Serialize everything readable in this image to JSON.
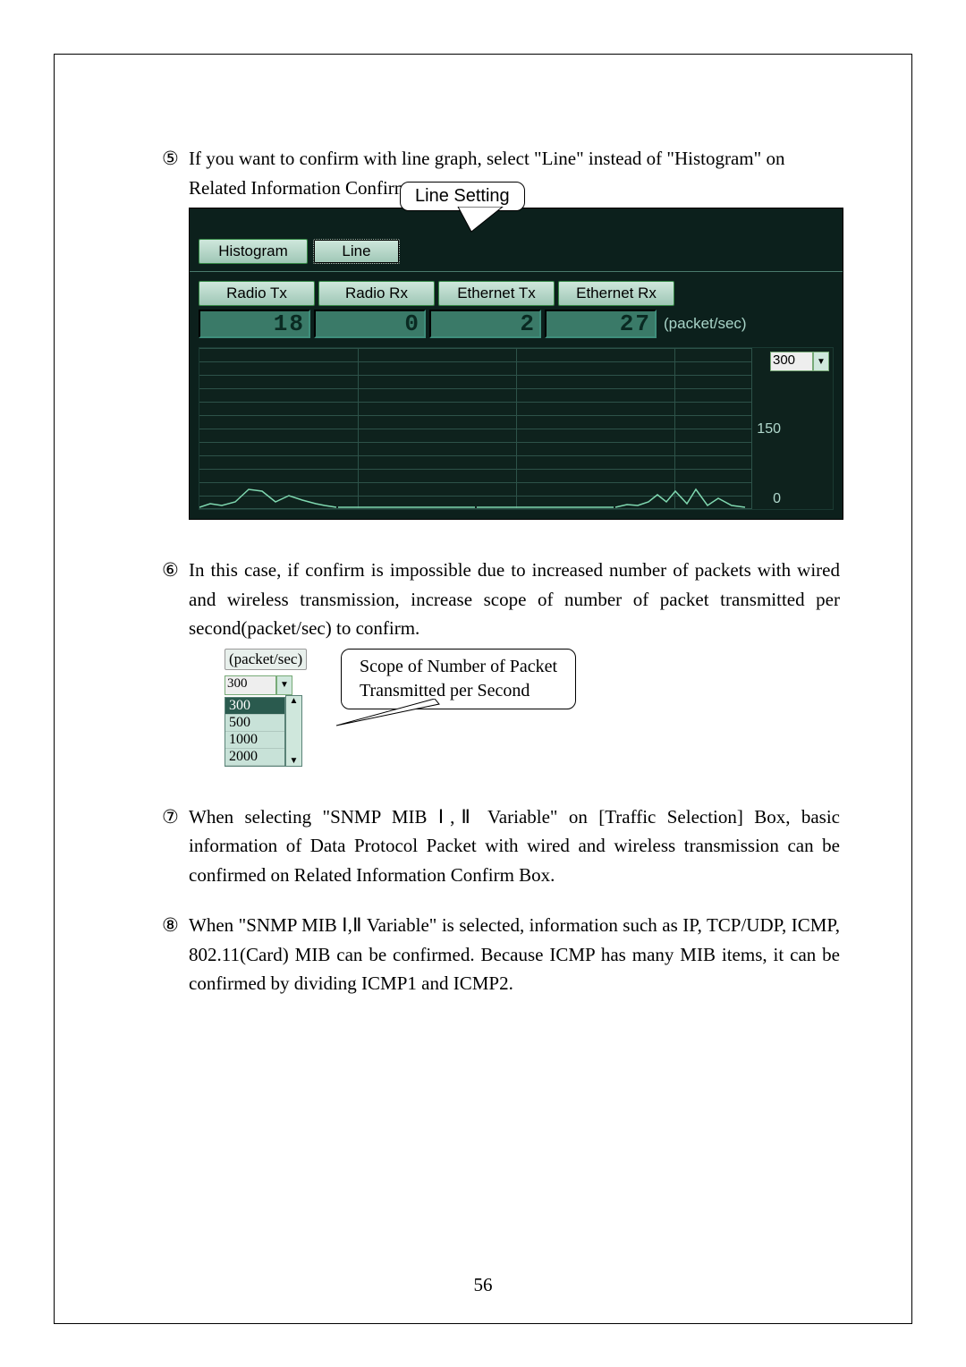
{
  "page_number": "56",
  "items": {
    "5": {
      "marker": "⑤",
      "text": "If you want to confirm with line graph, select \"Line\" instead of \"Histogram\" on Related Information Confirm Box."
    },
    "6": {
      "marker": "⑥",
      "text": "In this case, if confirm is impossible due to increased number of packets with wired and wireless transmission, increase scope of number of packet transmitted per second(packet/sec) to confirm."
    },
    "7": {
      "marker": "⑦",
      "text": "When selecting \"SNMP MIB Ⅰ,Ⅱ Variable\" on [Traffic Selection] Box, basic information of Data Protocol Packet with wired and wireless transmission can be confirmed on Related Information Confirm Box."
    },
    "8": {
      "marker": "⑧",
      "text": "When \"SNMP MIB Ⅰ,Ⅱ Variable\" is selected, information such as IP, TCP/UDP, ICMP, 802.11(Card) MIB can be confirmed. Because ICMP has many MIB items, it can be confirmed by dividing ICMP1 and ICMP2."
    }
  },
  "fig1": {
    "callout": "Line Setting",
    "tabs": {
      "histogram": "Histogram",
      "line": "Line"
    },
    "headers": {
      "radioTx": "Radio Tx",
      "radioRx": "Radio Rx",
      "ethTx": "Ethernet Tx",
      "ethRx": "Ethernet Rx"
    },
    "lcd": {
      "radioTx": "18",
      "radioRx": "0",
      "ethTx": "2",
      "ethRx": "27"
    },
    "unit": "(packet/sec)",
    "scale_value": "300",
    "y_mid": "150",
    "y_min": "0"
  },
  "fig2": {
    "unit": "(packet/sec)",
    "selected": "300",
    "options": [
      "300",
      "500",
      "1000",
      "2000"
    ],
    "callout_l1": "Scope of Number of Packet",
    "callout_l2": "Transmitted per Second"
  },
  "chart_data": {
    "type": "line",
    "title": "",
    "xlabel": "",
    "ylabel": "packet/sec",
    "ylim": [
      0,
      300
    ],
    "series": [
      {
        "name": "Radio Tx",
        "values": [
          5,
          10,
          8,
          12,
          30,
          15,
          10,
          20,
          12,
          8,
          6,
          4
        ]
      },
      {
        "name": "Radio Rx",
        "values": [
          0,
          0,
          0,
          0,
          0,
          0,
          0,
          0,
          0,
          0,
          0,
          0
        ]
      },
      {
        "name": "Ethernet Tx",
        "values": [
          0,
          0,
          0,
          0,
          0,
          0,
          0,
          0,
          0,
          0,
          0,
          0
        ]
      },
      {
        "name": "Ethernet Rx",
        "values": [
          3,
          6,
          5,
          8,
          20,
          10,
          25,
          8,
          30,
          6,
          15,
          5
        ]
      }
    ],
    "lcd_readout": {
      "Radio Tx": 18,
      "Radio Rx": 0,
      "Ethernet Tx": 2,
      "Ethernet Rx": 27
    },
    "scale_options": [
      300,
      500,
      1000,
      2000
    ]
  }
}
